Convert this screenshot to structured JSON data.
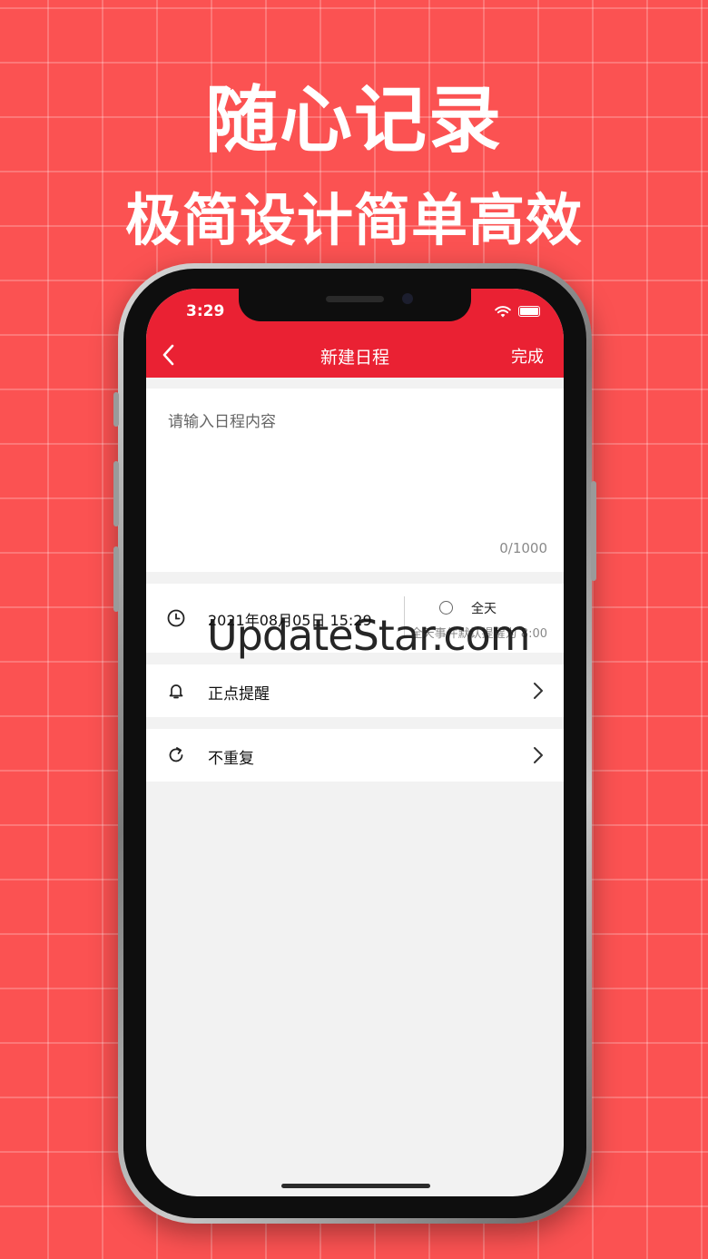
{
  "promo": {
    "headline": "随心记录",
    "subheadline": "极简设计简单高效"
  },
  "status_bar": {
    "time": "3:29"
  },
  "nav": {
    "title": "新建日程",
    "done_label": "完成"
  },
  "content": {
    "placeholder": "请输入日程内容",
    "counter": "0/1000"
  },
  "datetime": {
    "value": "2021年08月05日 15:29",
    "allday_label": "全天",
    "allday_checked": false,
    "allday_hint": "全天事件默认提醒为 8:00"
  },
  "reminder": {
    "label": "正点提醒"
  },
  "repeat": {
    "label": "不重复"
  },
  "watermark": "UpdateStar.com",
  "colors": {
    "background": "#fb5252",
    "nav_bar": "#ea2133",
    "screen_bg": "#f2f2f2"
  }
}
